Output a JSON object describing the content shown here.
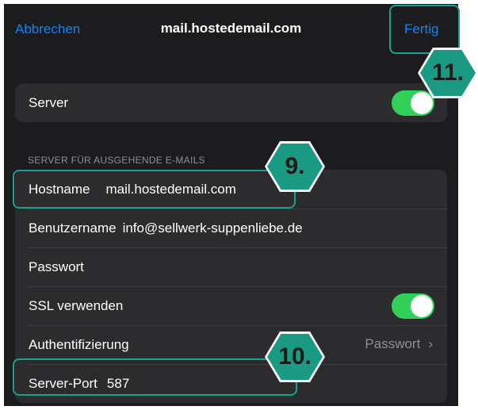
{
  "navbar": {
    "cancel_label": "Abbrechen",
    "title": "mail.hostedemail.com",
    "done_label": "Fertig"
  },
  "server_group": {
    "label": "Server",
    "toggle_on": true
  },
  "section_header": "SERVER FÜR AUSGEHENDE E-MAILS",
  "outgoing": {
    "hostname_label": "Hostname",
    "hostname_value": "mail.hostedemail.com",
    "username_label": "Benutzername",
    "username_value": "info@sellwerk-suppenliebe.de",
    "password_label": "Passwort",
    "ssl_label": "SSL verwenden",
    "ssl_on": true,
    "auth_label": "Authentifizierung",
    "auth_value": "Passwort",
    "port_label": "Server-Port",
    "port_value": "587"
  },
  "annotations": {
    "badge_9": "9.",
    "badge_10": "10.",
    "badge_11": "11."
  },
  "colors": {
    "accent": "#0a84ff",
    "toggle_on": "#30d158",
    "highlight": "#1aa08f",
    "badge": "#1a9a82"
  }
}
